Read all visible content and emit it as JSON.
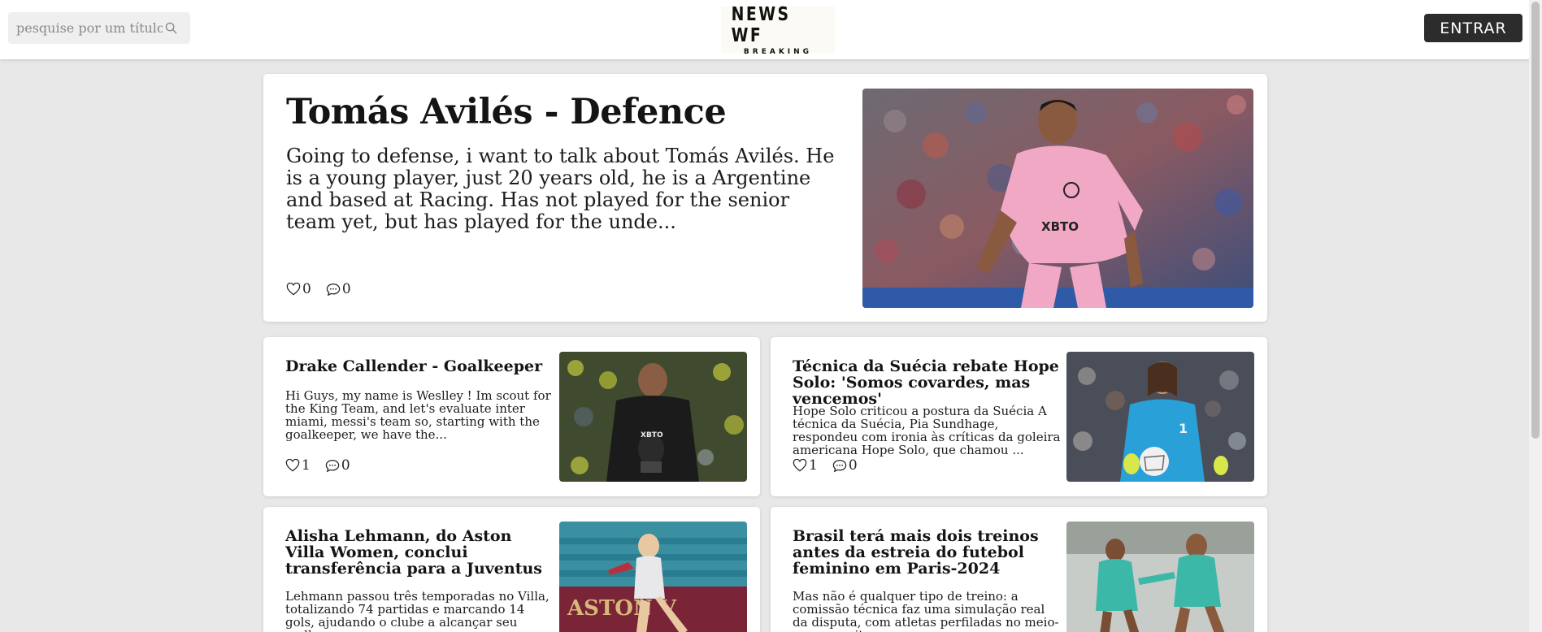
{
  "header": {
    "search_placeholder": "pesquise por um título",
    "search_icon": "search-icon",
    "logo_line1": "NEWS WF",
    "logo_line2": "BREAKING",
    "login_label": "ENTRAR"
  },
  "featured": {
    "title": "Tomás Avilés - Defence",
    "excerpt": "Going to defense, i want to talk about Tomás Avilés. He is a young player, just 20 years old, he is a Argentine and based at Racing. Has not played for the senior team yet, but has played for the unde...",
    "likes": "0",
    "comments": "0",
    "image": "soccer player in pink jersey on field"
  },
  "articles": [
    {
      "title": "Drake Callender - Goalkeeper",
      "excerpt": "Hi Guys, my name is Weslley ! Im scout for the King Team, and let's evaluate inter miami, messi's team so, starting with the goalkeeper, we have the...",
      "likes": "1",
      "comments": "0",
      "image": "goalkeeper in black jersey holding trophy"
    },
    {
      "title": "Técnica da Suécia rebate Hope Solo: 'Somos covardes, mas vencemos'",
      "excerpt": "Hope Solo criticou a postura da Suécia A técnica da Suécia, Pia Sundhage, respondeu com ironia às críticas da goleira americana Hope Solo, que chamou ...",
      "likes": "1",
      "comments": "0",
      "image": "goalkeeper in blue kit holding ball"
    },
    {
      "title": "Alisha Lehmann, do Aston Villa Women, conclui transferência para a Juventus",
      "excerpt": "Lehmann passou três temporadas no Villa, totalizando 74 partidas e marcando 14 gols, ajudando o clube a alcançar seu melhor",
      "image": "player kicking ball in stadium"
    },
    {
      "title": "Brasil terá mais dois treinos antes da estreia do futebol feminino em Paris-2024",
      "excerpt": "Mas não é qualquer tipo de treino: a comissão técnica faz uma simulação real da disputa, com atletas perfiladas no meio-campo, gritos",
      "image": "players training in teal kits"
    }
  ],
  "icons": {
    "like": "heart-icon",
    "comment": "comment-icon"
  }
}
